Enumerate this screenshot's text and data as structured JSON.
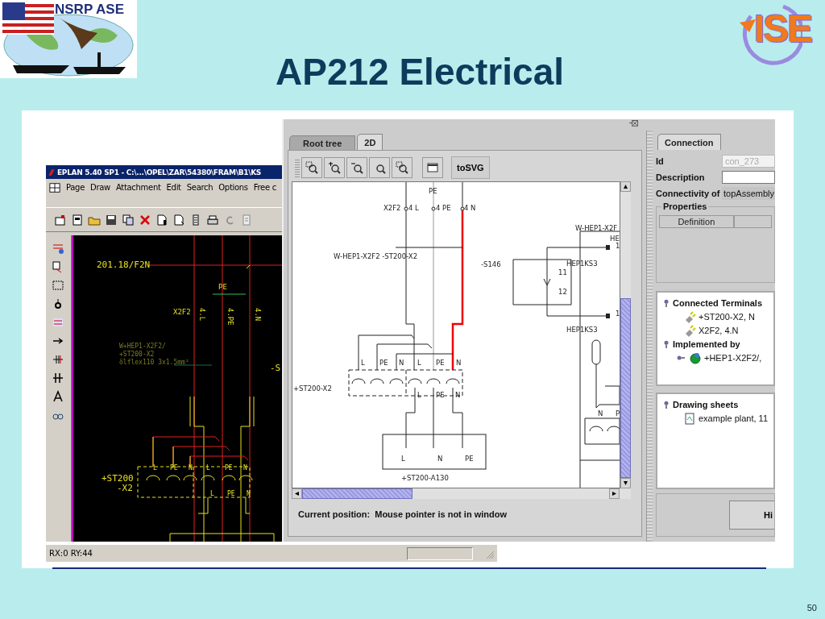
{
  "slide": {
    "title": "AP212 Electrical",
    "page_number": "50"
  },
  "logos": {
    "left": "NSRP ASE",
    "right": "ISE"
  },
  "eplan_window": {
    "title": "EPLAN 5.40 SP1 - C:\\...\\OPEL\\ZAR\\54380\\FRAM\\B1\\KS",
    "menu": [
      "Page",
      "Draw",
      "Attachment",
      "Edit",
      "Search",
      "Options",
      "Free c"
    ],
    "canvas_labels": [
      "201.18/F2N",
      "PE",
      "X2F2",
      "4.L",
      "4.PE",
      "4.N",
      "W+HEP1-X2F2/",
      "+ST200-X2",
      "ölflex110 3x1.5mm²",
      "-S",
      "+ST200",
      "-X2",
      "L",
      "PE",
      "N",
      "L",
      "PE",
      "N",
      "L",
      "PE",
      "N"
    ],
    "status": "RX:0 RY:44"
  },
  "viewer_window": {
    "tabs": [
      {
        "label": "Root tree",
        "selected": false
      },
      {
        "label": "2D",
        "selected": true
      }
    ],
    "toolbar_button": "toSVG",
    "canvas_labels": [
      "PE",
      "X2F2",
      "4 L",
      "4 PE",
      "4 N",
      "W-HEP1-X2F2 -ST200-X2",
      "W-HEP1-X2F",
      "HE",
      "1",
      "-S146",
      "11",
      "12",
      "HEP1KS3",
      "1",
      "HEP1KS3",
      "L",
      "PE",
      "N",
      "L",
      "PE",
      "N",
      "+ST200-X2",
      "L",
      "PE",
      "N",
      "L",
      "N",
      "PE",
      "+ST200-A130",
      "N",
      "P"
    ],
    "status_label": "Current position:",
    "status_text": "Mouse pointer is not in window"
  },
  "details_panel": {
    "tab": {
      "label": "Connection",
      "selected": true
    },
    "fields": [
      {
        "label": "Id",
        "kind": "input",
        "value": "con_273",
        "disabled": true
      },
      {
        "label": "Description",
        "kind": "input",
        "disabled": false
      },
      {
        "label": "Connectivity of",
        "kind": "display",
        "value": "topAssembly"
      }
    ],
    "properties": {
      "title": "Properties",
      "columns": [
        "Definition"
      ]
    },
    "tree": [
      {
        "label": "Connected Terminals",
        "expanded": true,
        "children": [
          {
            "label": "+ST200-X2, N",
            "kind": "terminal"
          },
          {
            "label": "X2F2, 4.N",
            "kind": "terminal"
          }
        ]
      },
      {
        "label": "Implemented by",
        "expanded": true,
        "children": [
          {
            "label": "+HEP1-X2F2/,",
            "kind": "component",
            "expanded": false
          }
        ]
      }
    ],
    "sheets": [
      {
        "label": "Drawing sheets",
        "expanded": true,
        "children": [
          {
            "label": "example plant, 11",
            "kind": "sheet"
          }
        ]
      }
    ],
    "button": "Hi"
  }
}
